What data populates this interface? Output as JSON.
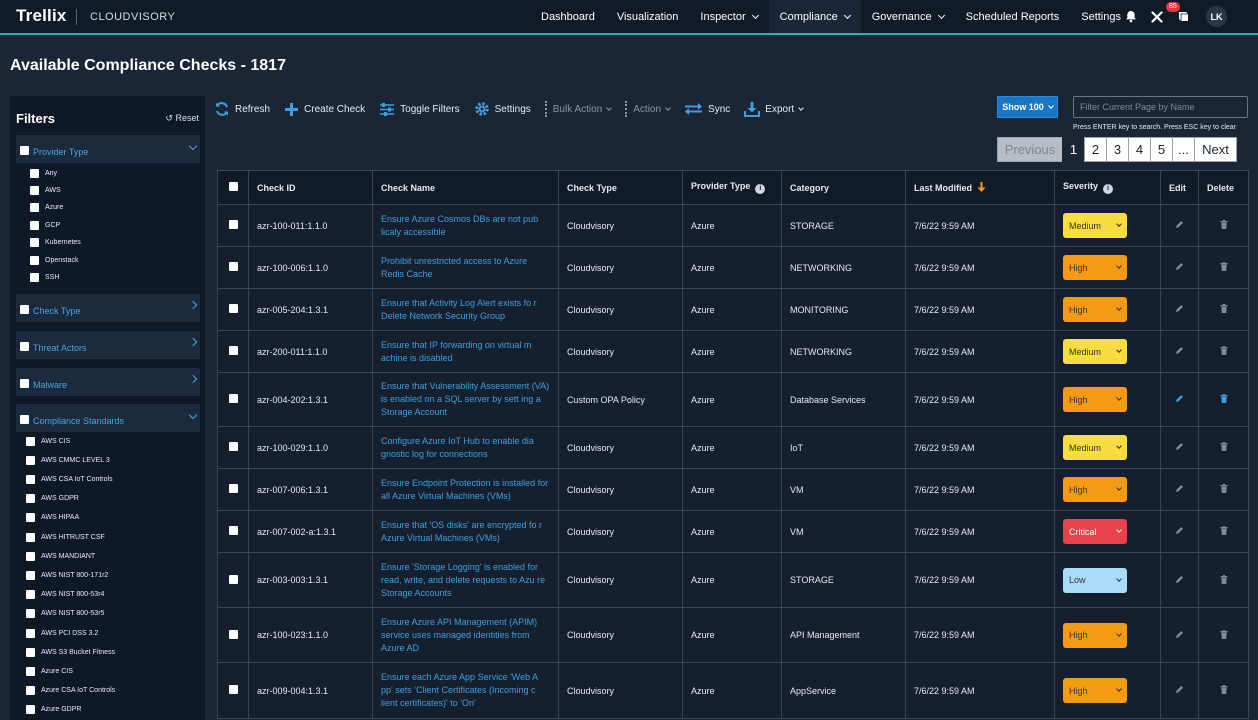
{
  "header": {
    "logo": "Trellix",
    "product": "CLOUDVISORY",
    "nav": [
      {
        "label": "Dashboard",
        "dropdown": false
      },
      {
        "label": "Visualization",
        "dropdown": false
      },
      {
        "label": "Inspector",
        "dropdown": true
      },
      {
        "label": "Compliance",
        "dropdown": true,
        "active": true
      },
      {
        "label": "Governance",
        "dropdown": true
      },
      {
        "label": "Scheduled Reports",
        "dropdown": false
      },
      {
        "label": "Settings",
        "dropdown": true
      }
    ],
    "icons": [
      "bell-icon",
      "tools-icon",
      "book-icon"
    ],
    "notification_badge": "85",
    "avatar_initials": "LK"
  },
  "page_title": "Available Compliance Checks - 1817",
  "filters": {
    "title": "Filters",
    "reset_label": "Reset",
    "provider_type": {
      "label": "Provider Type",
      "options": [
        "Any",
        "AWS",
        "Azure",
        "GCP",
        "Kubernetes",
        "Openstack",
        "SSH"
      ]
    },
    "check_type": {
      "label": "Check Type"
    },
    "threat_actors": {
      "label": "Threat Actors"
    },
    "malware": {
      "label": "Malware"
    },
    "compliance_standards": {
      "label": "Compliance Standards",
      "options": [
        "AWS CIS",
        "AWS CMMC LEVEL 3",
        "AWS CSA IoT Controls",
        "AWS GDPR",
        "AWS HIPAA",
        "AWS HITRUST CSF",
        "AWS MANDIANT",
        "AWS NIST 800-171r2",
        "AWS NIST 800-53r4",
        "AWS NIST 800-53r5",
        "AWS PCI DSS 3.2",
        "AWS S3 Bucket Fitness",
        "Azure CIS",
        "Azure CSA IoT Controls",
        "Azure GDPR"
      ]
    }
  },
  "toolbar": {
    "refresh": "Refresh",
    "create_check": "Create Check",
    "toggle_filters": "Toggle Filters",
    "settings": "Settings",
    "bulk_action": "Bulk Action",
    "action": "Action",
    "sync": "Sync",
    "export": "Export"
  },
  "show_count": "Show 100",
  "search": {
    "placeholder": "Filter Current Page by Name",
    "hint": "Press ENTER key to search. Press ESC key to clear"
  },
  "pagination": {
    "previous": "Previous",
    "pages": [
      "1",
      "2",
      "3",
      "4",
      "5",
      "..."
    ],
    "next": "Next",
    "active": "1"
  },
  "table": {
    "columns": {
      "check_id": "Check ID",
      "check_name": "Check Name",
      "check_type": "Check Type",
      "provider_type": "Provider Type",
      "category": "Category",
      "last_modified": "Last Modified",
      "severity": "Severity",
      "edit": "Edit",
      "delete": "Delete"
    },
    "rows": [
      {
        "id": "azr-100-011:1.1.0",
        "name": "Ensure Azure Cosmos DBs are not pub licaly accessible",
        "type": "Cloudvisory",
        "provider": "Azure",
        "category": "STORAGE",
        "modified": "7/6/22 9:59 AM",
        "severity": "Medium",
        "editable": false
      },
      {
        "id": "azr-100-006:1.1.0",
        "name": "Prohibit unrestricted access to Azure Redis Cache",
        "type": "Cloudvisory",
        "provider": "Azure",
        "category": "NETWORKING",
        "modified": "7/6/22 9:59 AM",
        "severity": "High",
        "editable": false
      },
      {
        "id": "azr-005-204:1.3.1",
        "name": "Ensure that Activity Log Alert exists fo r Delete Network Security Group",
        "type": "Cloudvisory",
        "provider": "Azure",
        "category": "MONITORING",
        "modified": "7/6/22 9:59 AM",
        "severity": "High",
        "editable": false
      },
      {
        "id": "azr-200-011:1.1.0",
        "name": "Ensure that IP forwarding on virtual m achine is disabled",
        "type": "Cloudvisory",
        "provider": "Azure",
        "category": "NETWORKING",
        "modified": "7/6/22 9:59 AM",
        "severity": "Medium",
        "editable": false
      },
      {
        "id": "azr-004-202:1.3.1",
        "name": "Ensure that Vulnerability Assessment (VA) is enabled on a SQL server by sett ing a Storage Account",
        "type": "Custom OPA Policy",
        "provider": "Azure",
        "category": "Database Services",
        "modified": "7/6/22 9:59 AM",
        "severity": "High",
        "editable": true
      },
      {
        "id": "azr-100-029:1.1.0",
        "name": "Configure Azure IoT Hub to enable dia gnostic log for connections",
        "type": "Cloudvisory",
        "provider": "Azure",
        "category": "IoT",
        "modified": "7/6/22 9:59 AM",
        "severity": "Medium",
        "editable": false
      },
      {
        "id": "azr-007-006:1.3.1",
        "name": "Ensure Endpoint Protection is installed for all Azure Virtual Machines (VMs)",
        "type": "Cloudvisory",
        "provider": "Azure",
        "category": "VM",
        "modified": "7/6/22 9:59 AM",
        "severity": "High",
        "editable": false
      },
      {
        "id": "azr-007-002-a:1.3.1",
        "name": "Ensure that 'OS disks' are encrypted fo r Azure Virtual Machines (VMs)",
        "type": "Cloudvisory",
        "provider": "Azure",
        "category": "VM",
        "modified": "7/6/22 9:59 AM",
        "severity": "Critical",
        "editable": false
      },
      {
        "id": "azr-003-003:1.3.1",
        "name": "Ensure 'Storage Logging' is enabled for read, write, and delete requests to Azu re Storage Accounts",
        "type": "Cloudvisory",
        "provider": "Azure",
        "category": "STORAGE",
        "modified": "7/6/22 9:59 AM",
        "severity": "Low",
        "editable": false
      },
      {
        "id": "azr-100-023:1.1.0",
        "name": "Ensure Azure API Management (APIM) service uses managed identities from Azure AD",
        "type": "Cloudvisory",
        "provider": "Azure",
        "category": "API Management",
        "modified": "7/6/22 9:59 AM",
        "severity": "High",
        "editable": false
      },
      {
        "id": "azr-009-004:1.3.1",
        "name": "Ensure each Azure App Service 'Web A pp' sets 'Client Certificates (Incoming c lient certificates)' to 'On'",
        "type": "Cloudvisory",
        "provider": "Azure",
        "category": "AppService",
        "modified": "7/6/22 9:59 AM",
        "severity": "High",
        "editable": false
      }
    ]
  },
  "colors": {
    "accent": "#25b8a8",
    "link": "#3fa0e0",
    "medium": "#f7dd3f",
    "high": "#f59a13",
    "critical": "#e8424f",
    "low": "#a9dcf7"
  }
}
